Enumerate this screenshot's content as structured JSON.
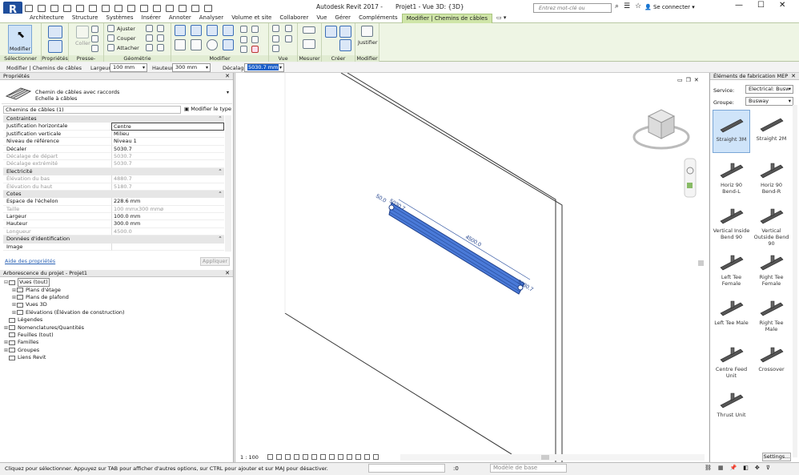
{
  "app": {
    "logo": "R",
    "title": "Autodesk Revit 2017 -",
    "document": "Projet1 - Vue 3D: {3D}",
    "search_placeholder": "Entrez mot-clé ou expression",
    "signin": "Se connecter",
    "minimize": "—",
    "maximize": "☐",
    "close": "✕"
  },
  "ribbon": {
    "tabs": [
      "Architecture",
      "Structure",
      "Systèmes",
      "Insérer",
      "Annoter",
      "Analyser",
      "Volume et site",
      "Collaborer",
      "Vue",
      "Gérer",
      "Compléments",
      "Modifier | Chemins de câbles"
    ],
    "active_tab": "Modifier | Chemins de câbles",
    "modify_label": "Modifier",
    "panels": [
      "Sélectionner",
      "Propriétés",
      "Presse-papiers",
      "Géométrie",
      "Modifier",
      "Vue",
      "Mesurer",
      "Créer",
      "Modifier"
    ],
    "clipboard": {
      "paste": "Coller"
    },
    "geometry": {
      "cut": "Ajuster",
      "join": "Couper",
      "attach": "Attacher"
    },
    "justify_label": "Justifier"
  },
  "options_bar": {
    "context": "Modifier | Chemins de câbles",
    "width_label": "Largeur:",
    "width_value": "100 mm",
    "height_label": "Hauteur:",
    "height_value": "300 mm",
    "offset_label": "Décalage:",
    "offset_value": "5030.7 mm"
  },
  "properties": {
    "title": "Propriétés",
    "close": "✕",
    "type_family": "Chemin de câbles avec raccords",
    "type_name": "Echelle à câbles",
    "instance_filter": "Chemins de câbles (1)",
    "edit_type": "Modifier le type",
    "rows": [
      {
        "kind": "sec",
        "k": "Contraintes"
      },
      {
        "kind": "sel",
        "k": "Justification horizontale",
        "v": "Centre"
      },
      {
        "kind": "n",
        "k": "Justification verticale",
        "v": "Milieu"
      },
      {
        "kind": "n",
        "k": "Niveau de référence",
        "v": "Niveau 1"
      },
      {
        "kind": "n",
        "k": "Décaler",
        "v": "5030.7"
      },
      {
        "kind": "grey",
        "k": "Décalage de départ",
        "v": "5030.7"
      },
      {
        "kind": "grey",
        "k": "Décalage extrémité",
        "v": "5030.7"
      },
      {
        "kind": "sec",
        "k": "Electricité"
      },
      {
        "kind": "grey",
        "k": "Élévation du bas",
        "v": "4880.7"
      },
      {
        "kind": "grey",
        "k": "Élévation du haut",
        "v": "5180.7"
      },
      {
        "kind": "sec",
        "k": "Cotes"
      },
      {
        "kind": "n",
        "k": "Espace de l'échelon",
        "v": "228.6 mm"
      },
      {
        "kind": "grey",
        "k": "Taille",
        "v": "100 mmx300 mmø"
      },
      {
        "kind": "n",
        "k": "Largeur",
        "v": "100.0 mm"
      },
      {
        "kind": "n",
        "k": "Hauteur",
        "v": "300.0 mm"
      },
      {
        "kind": "grey",
        "k": "Longueur",
        "v": "4500.0"
      },
      {
        "kind": "sec",
        "k": "Données d'identification"
      },
      {
        "kind": "n",
        "k": "Image",
        "v": ""
      }
    ],
    "help": "Aide des propriétés",
    "apply": "Appliquer"
  },
  "browser": {
    "title": "Arborescence du projet - Projet1",
    "close": "✕",
    "nodes": [
      {
        "indent": 0,
        "toggle": "⊟",
        "label": "Vues (tout)",
        "sel": true
      },
      {
        "indent": 1,
        "toggle": "⊞",
        "label": "Plans d'étage"
      },
      {
        "indent": 1,
        "toggle": "⊞",
        "label": "Plans de plafond"
      },
      {
        "indent": 1,
        "toggle": "⊞",
        "label": "Vues 3D"
      },
      {
        "indent": 1,
        "toggle": "⊞",
        "label": "Elévations (Élévation de construction)"
      },
      {
        "indent": 0,
        "toggle": "",
        "label": "Légendes"
      },
      {
        "indent": 0,
        "toggle": "⊞",
        "label": "Nomenclatures/Quantités"
      },
      {
        "indent": 0,
        "toggle": "",
        "label": "Feuilles (tout)"
      },
      {
        "indent": 0,
        "toggle": "⊞",
        "label": "Familles"
      },
      {
        "indent": 0,
        "toggle": "⊞",
        "label": "Groupes"
      },
      {
        "indent": 0,
        "toggle": "",
        "label": "Liens Revit"
      }
    ]
  },
  "viewport": {
    "scale": "1 : 100",
    "dims": {
      "left": "50.0",
      "start": "5030.7",
      "length": "4500.0",
      "end": "5030.7"
    },
    "viewcube": "viewcube"
  },
  "fabrication": {
    "title": "Éléments de fabrication MEP",
    "close": "✕",
    "service_label": "Service:",
    "service_value": "Electrical: Busw",
    "group_label": "Groupe:",
    "group_value": "Busway",
    "items": [
      "Straight 3M",
      "Straight 2M",
      "Horiz 90 Bend-L",
      "Horiz 90 Bend-R",
      "Vertical Inside Bend 90",
      "Vertical Outside Bend 90",
      "Left Tee Female",
      "Right Tee Female",
      "Left Tee Male",
      "Right Tee Male",
      "Centre Feed Unit",
      "Crossover",
      "Thrust Unit"
    ],
    "selected": "Straight 3M",
    "settings": "Settings..."
  },
  "status": {
    "message": "Cliquez pour sélectionner. Appuyez sur TAB pour afficher d'autres options, sur CTRL pour ajouter et sur MAJ pour désactiver.",
    "zero": ":0",
    "model": "Modèle de base"
  },
  "colors": {
    "ribbon_green": "#cfe5a8",
    "selection_blue": "#4a7ad8",
    "revit_blue": "#1f4e9c"
  }
}
